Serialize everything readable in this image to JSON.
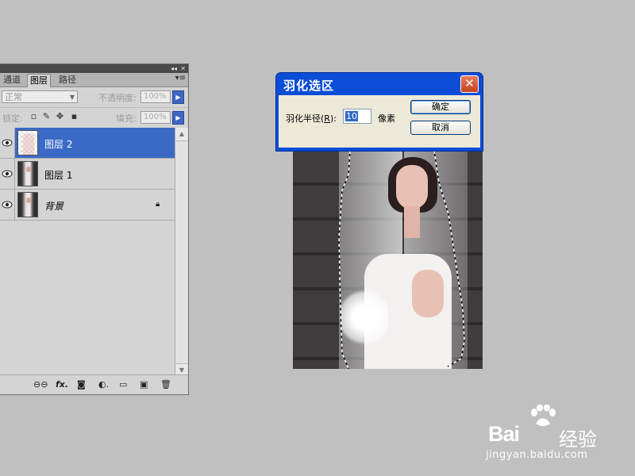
{
  "layers_panel": {
    "tabs": [
      {
        "label": "通道",
        "active": false
      },
      {
        "label": "图层",
        "active": true
      },
      {
        "label": "路径",
        "active": false
      }
    ],
    "blend_mode": "正常",
    "opacity_label": "不透明度:",
    "opacity_value": "100%",
    "lock_label": "锁定:",
    "fill_label": "填充:",
    "fill_value": "100%",
    "layers": [
      {
        "name": "图层 2",
        "selected": true,
        "visible": true,
        "locked": false,
        "thumbnail": "transparent-checker"
      },
      {
        "name": "图层 1",
        "selected": false,
        "visible": true,
        "locked": false,
        "thumbnail": "bride-photo"
      },
      {
        "name": "背景",
        "selected": false,
        "visible": true,
        "locked": true,
        "thumbnail": "bride-photo"
      }
    ],
    "bottom_icons": [
      "link-icon",
      "fx-icon",
      "mask-icon",
      "adjustment-icon",
      "group-icon",
      "new-layer-icon",
      "trash-icon"
    ],
    "fx_label": "fx."
  },
  "dialog": {
    "title": "羽化选区",
    "field_label_prefix": "羽化半径(",
    "field_label_key": "R",
    "field_label_suffix": "):",
    "radius_value": "10",
    "unit": "像素",
    "ok_label": "确定",
    "cancel_label": "取消",
    "close_glyph": "✕"
  },
  "watermark": {
    "brand": "Bai",
    "brand_suffix": "经验",
    "url": "jingyan.baidu.com"
  },
  "colors": {
    "selected_layer": "#3a6ac6",
    "dialog_titlebar": "#0c4dd8",
    "workspace": "#c0c0c0"
  }
}
